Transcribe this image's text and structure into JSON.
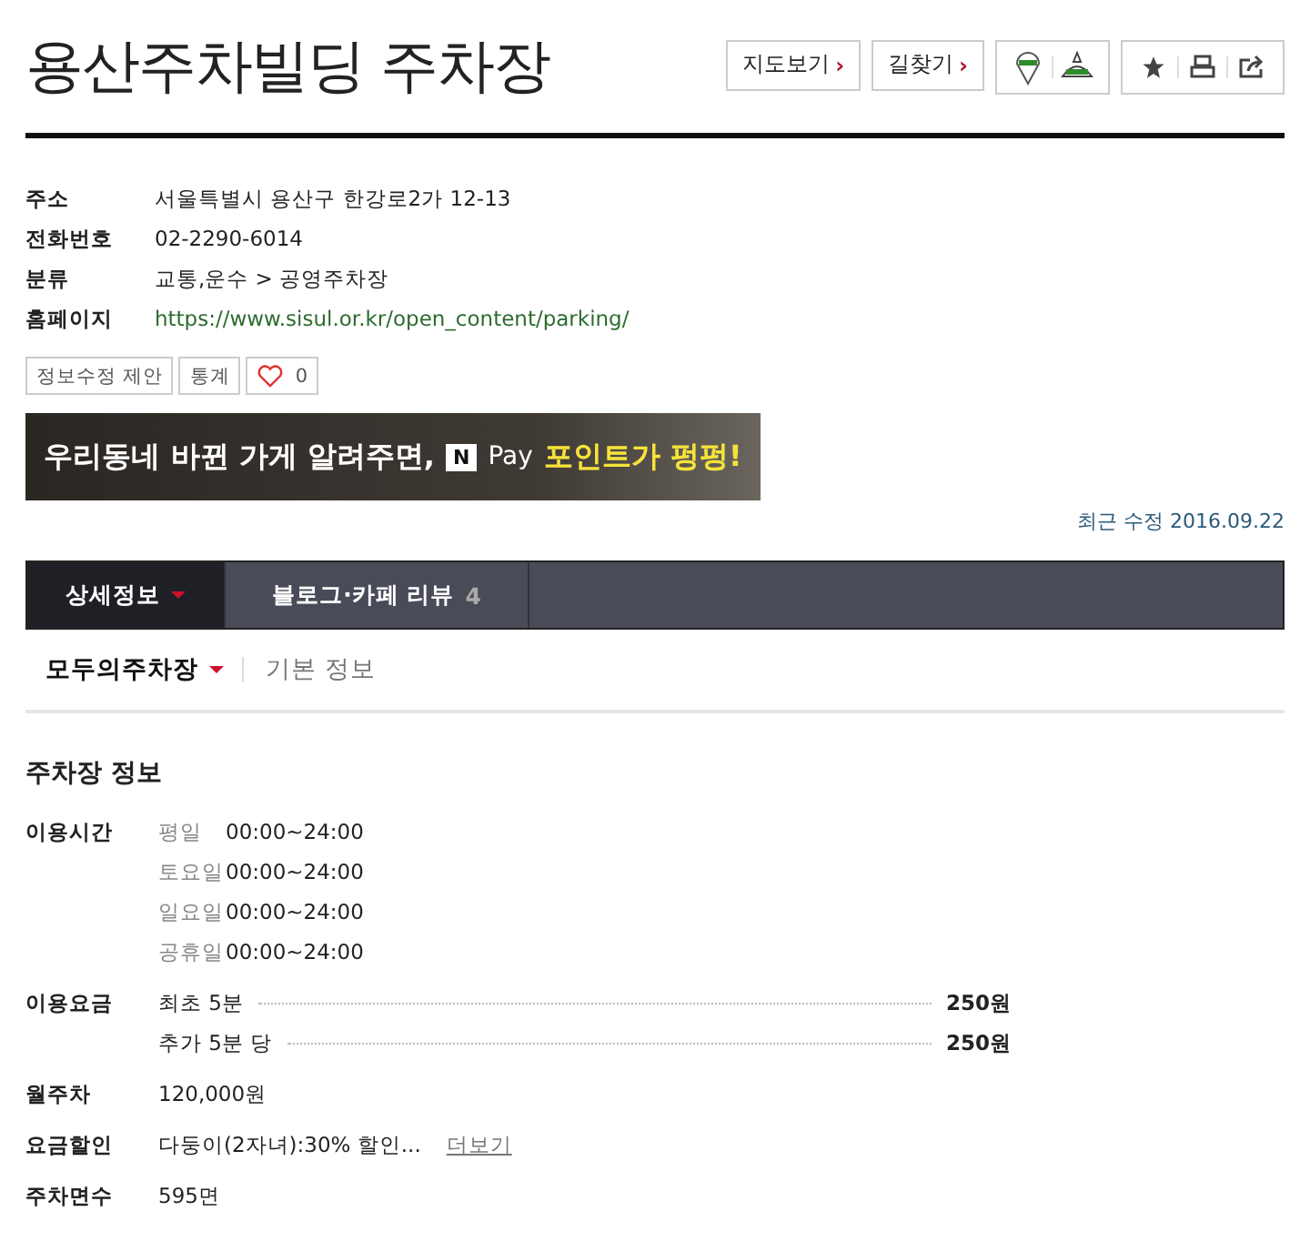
{
  "title": "용산주차빌딩 주차장",
  "header_buttons": [
    {
      "label": "지도보기",
      "caret": "›"
    },
    {
      "label": "길찾기",
      "caret": "›"
    }
  ],
  "info": [
    {
      "label": "주소",
      "value": "서울특별시 용산구 한강로2가 12-13",
      "kind": "text"
    },
    {
      "label": "전화번호",
      "value": "02-2290-6014",
      "kind": "text"
    },
    {
      "label": "분류",
      "value": "교통,운수 > 공영주차장",
      "kind": "text"
    },
    {
      "label": "홈페이지",
      "value": "https://www.sisul.or.kr/open_content/parking/",
      "kind": "link"
    }
  ],
  "actions": [
    "정보수정 제안",
    "통계"
  ],
  "likes": "0",
  "banner": {
    "text": "우리동네 바뀐 가게 알려주면,",
    "badge": "N",
    "pay": "Pay",
    "highlight": "포인트가 펑펑!"
  },
  "updated": "최근 수정 2016.09.22",
  "tabs": [
    {
      "label": "상세정보",
      "selected": true
    },
    {
      "label": "블로그·카페 리뷰",
      "count": "4",
      "selected": false
    }
  ],
  "subtabs": [
    {
      "label": "모두의주차장",
      "selected": true
    },
    {
      "label": "기본 정보",
      "selected": false
    }
  ],
  "section_title": "주차장 정보",
  "hours": {
    "label": "이용시간",
    "rows": [
      {
        "day": "평일",
        "time": "00:00~24:00"
      },
      {
        "day": "토요일",
        "time": "00:00~24:00"
      },
      {
        "day": "일요일",
        "time": "00:00~24:00"
      },
      {
        "day": "공휴일",
        "time": "00:00~24:00"
      }
    ]
  },
  "fees": {
    "label": "이용요금",
    "rows": [
      {
        "name": "최초 5분",
        "price": "250원"
      },
      {
        "name": "추가 5분 당",
        "price": "250원"
      }
    ]
  },
  "monthly": {
    "label": "월주차",
    "value": "120,000원"
  },
  "discount": {
    "label": "요금할인",
    "value": "다둥이(2자녀):30% 할인...",
    "more": "더보기"
  },
  "spaces": {
    "label": "주차면수",
    "value": "595면"
  }
}
